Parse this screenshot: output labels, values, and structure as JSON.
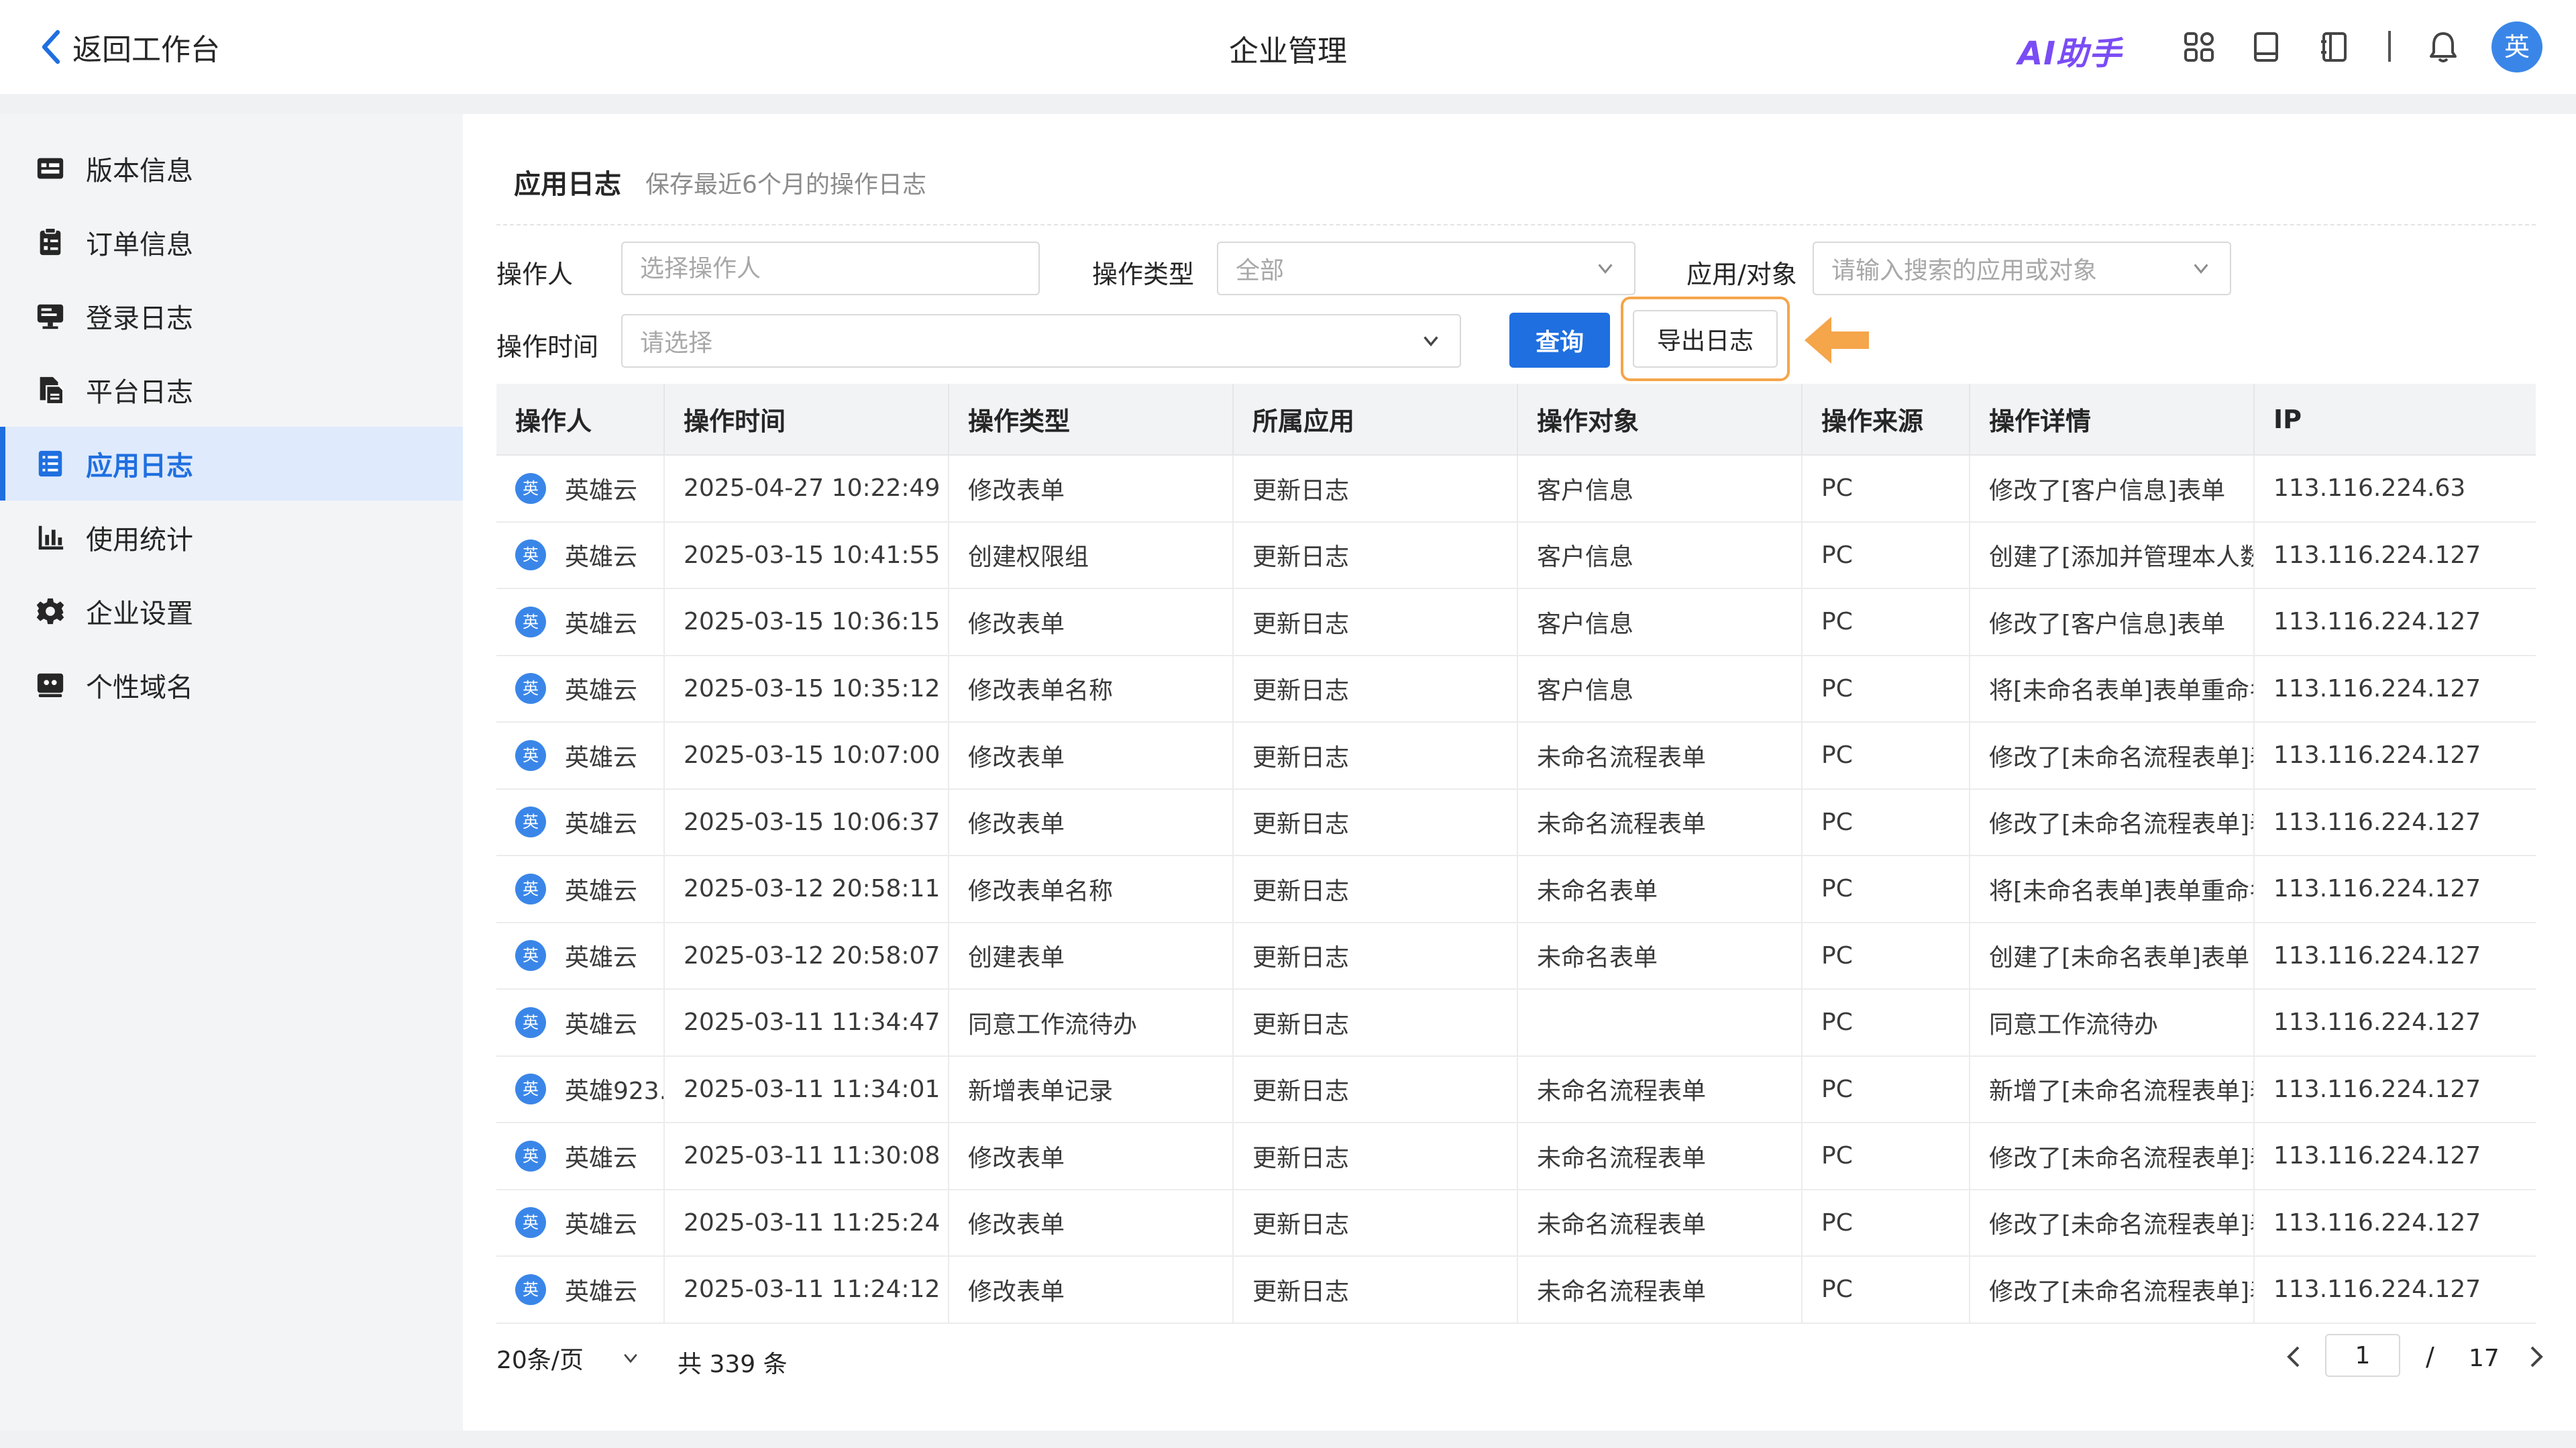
{
  "header": {
    "back_label": "返回工作台",
    "title": "企业管理",
    "ai_label": "AI助手",
    "avatar_text": "英"
  },
  "sidebar": {
    "items": [
      {
        "label": "版本信息",
        "icon": "version-info-icon"
      },
      {
        "label": "订单信息",
        "icon": "order-clipboard-icon"
      },
      {
        "label": "登录日志",
        "icon": "monitor-icon"
      },
      {
        "label": "平台日志",
        "icon": "document-copy-icon"
      },
      {
        "label": "应用日志",
        "icon": "list-icon",
        "active": true
      },
      {
        "label": "使用统计",
        "icon": "bar-chart-icon"
      },
      {
        "label": "企业设置",
        "icon": "gear-icon"
      },
      {
        "label": "个性域名",
        "icon": "domain-icon"
      }
    ]
  },
  "section": {
    "title": "应用日志",
    "subtitle": "保存最近6个月的操作日志"
  },
  "filters": {
    "operator_label": "操作人",
    "operator_placeholder": "选择操作人",
    "type_label": "操作类型",
    "type_value": "全部",
    "app_label": "应用/对象",
    "app_placeholder": "请输入搜索的应用或对象",
    "time_label": "操作时间",
    "time_placeholder": "请选择",
    "query_label": "查询",
    "export_label": "导出日志"
  },
  "colors": {
    "primary": "#1f6fe0",
    "highlight": "#f5a54a",
    "ai_text": "#7a4cf5",
    "avatar": "#3a86e8"
  },
  "table": {
    "columns": [
      "操作人",
      "操作时间",
      "操作类型",
      "所属应用",
      "操作对象",
      "操作来源",
      "操作详情",
      "IP"
    ],
    "rows": [
      {
        "avatar": "英",
        "user": "英雄云",
        "time": "2025-04-27 10:22:49",
        "type": "修改表单",
        "app": "更新日志",
        "object": "客户信息",
        "source": "PC",
        "detail": "修改了[客户信息]表单",
        "ip": "113.116.224.63"
      },
      {
        "avatar": "英",
        "user": "英雄云",
        "time": "2025-03-15 10:41:55",
        "type": "创建权限组",
        "app": "更新日志",
        "object": "客户信息",
        "source": "PC",
        "detail": "创建了[添加并管理本人数",
        "ip": "113.116.224.127"
      },
      {
        "avatar": "英",
        "user": "英雄云",
        "time": "2025-03-15 10:36:15",
        "type": "修改表单",
        "app": "更新日志",
        "object": "客户信息",
        "source": "PC",
        "detail": "修改了[客户信息]表单",
        "ip": "113.116.224.127"
      },
      {
        "avatar": "英",
        "user": "英雄云",
        "time": "2025-03-15 10:35:12",
        "type": "修改表单名称",
        "app": "更新日志",
        "object": "客户信息",
        "source": "PC",
        "detail": "将[未命名表单]表单重命名",
        "ip": "113.116.224.127"
      },
      {
        "avatar": "英",
        "user": "英雄云",
        "time": "2025-03-15 10:07:00",
        "type": "修改表单",
        "app": "更新日志",
        "object": "未命名流程表单",
        "source": "PC",
        "detail": "修改了[未命名流程表单]表",
        "ip": "113.116.224.127"
      },
      {
        "avatar": "英",
        "user": "英雄云",
        "time": "2025-03-15 10:06:37",
        "type": "修改表单",
        "app": "更新日志",
        "object": "未命名流程表单",
        "source": "PC",
        "detail": "修改了[未命名流程表单]表",
        "ip": "113.116.224.127"
      },
      {
        "avatar": "英",
        "user": "英雄云",
        "time": "2025-03-12 20:58:11",
        "type": "修改表单名称",
        "app": "更新日志",
        "object": "未命名表单",
        "source": "PC",
        "detail": "将[未命名表单]表单重命名",
        "ip": "113.116.224.127"
      },
      {
        "avatar": "英",
        "user": "英雄云",
        "time": "2025-03-12 20:58:07",
        "type": "创建表单",
        "app": "更新日志",
        "object": "未命名表单",
        "source": "PC",
        "detail": "创建了[未命名表单]表单",
        "ip": "113.116.224.127"
      },
      {
        "avatar": "英",
        "user": "英雄云",
        "time": "2025-03-11 11:34:47",
        "type": "同意工作流待办",
        "app": "更新日志",
        "object": "",
        "source": "PC",
        "detail": "同意工作流待办",
        "ip": "113.116.224.127"
      },
      {
        "avatar": "英",
        "user": "英雄923.",
        "time": "2025-03-11 11:34:01",
        "type": "新增表单记录",
        "app": "更新日志",
        "object": "未命名流程表单",
        "source": "PC",
        "detail": "新增了[未命名流程表单]表",
        "ip": "113.116.224.127"
      },
      {
        "avatar": "英",
        "user": "英雄云",
        "time": "2025-03-11 11:30:08",
        "type": "修改表单",
        "app": "更新日志",
        "object": "未命名流程表单",
        "source": "PC",
        "detail": "修改了[未命名流程表单]表",
        "ip": "113.116.224.127"
      },
      {
        "avatar": "英",
        "user": "英雄云",
        "time": "2025-03-11 11:25:24",
        "type": "修改表单",
        "app": "更新日志",
        "object": "未命名流程表单",
        "source": "PC",
        "detail": "修改了[未命名流程表单]表",
        "ip": "113.116.224.127"
      },
      {
        "avatar": "英",
        "user": "英雄云",
        "time": "2025-03-11 11:24:12",
        "type": "修改表单",
        "app": "更新日志",
        "object": "未命名流程表单",
        "source": "PC",
        "detail": "修改了[未命名流程表单]表",
        "ip": "113.116.224.127"
      }
    ]
  },
  "pagination": {
    "page_size_label": "20条/页",
    "total_label": "共 339 条",
    "current_page": "1",
    "separator": "/",
    "total_pages": "17"
  }
}
